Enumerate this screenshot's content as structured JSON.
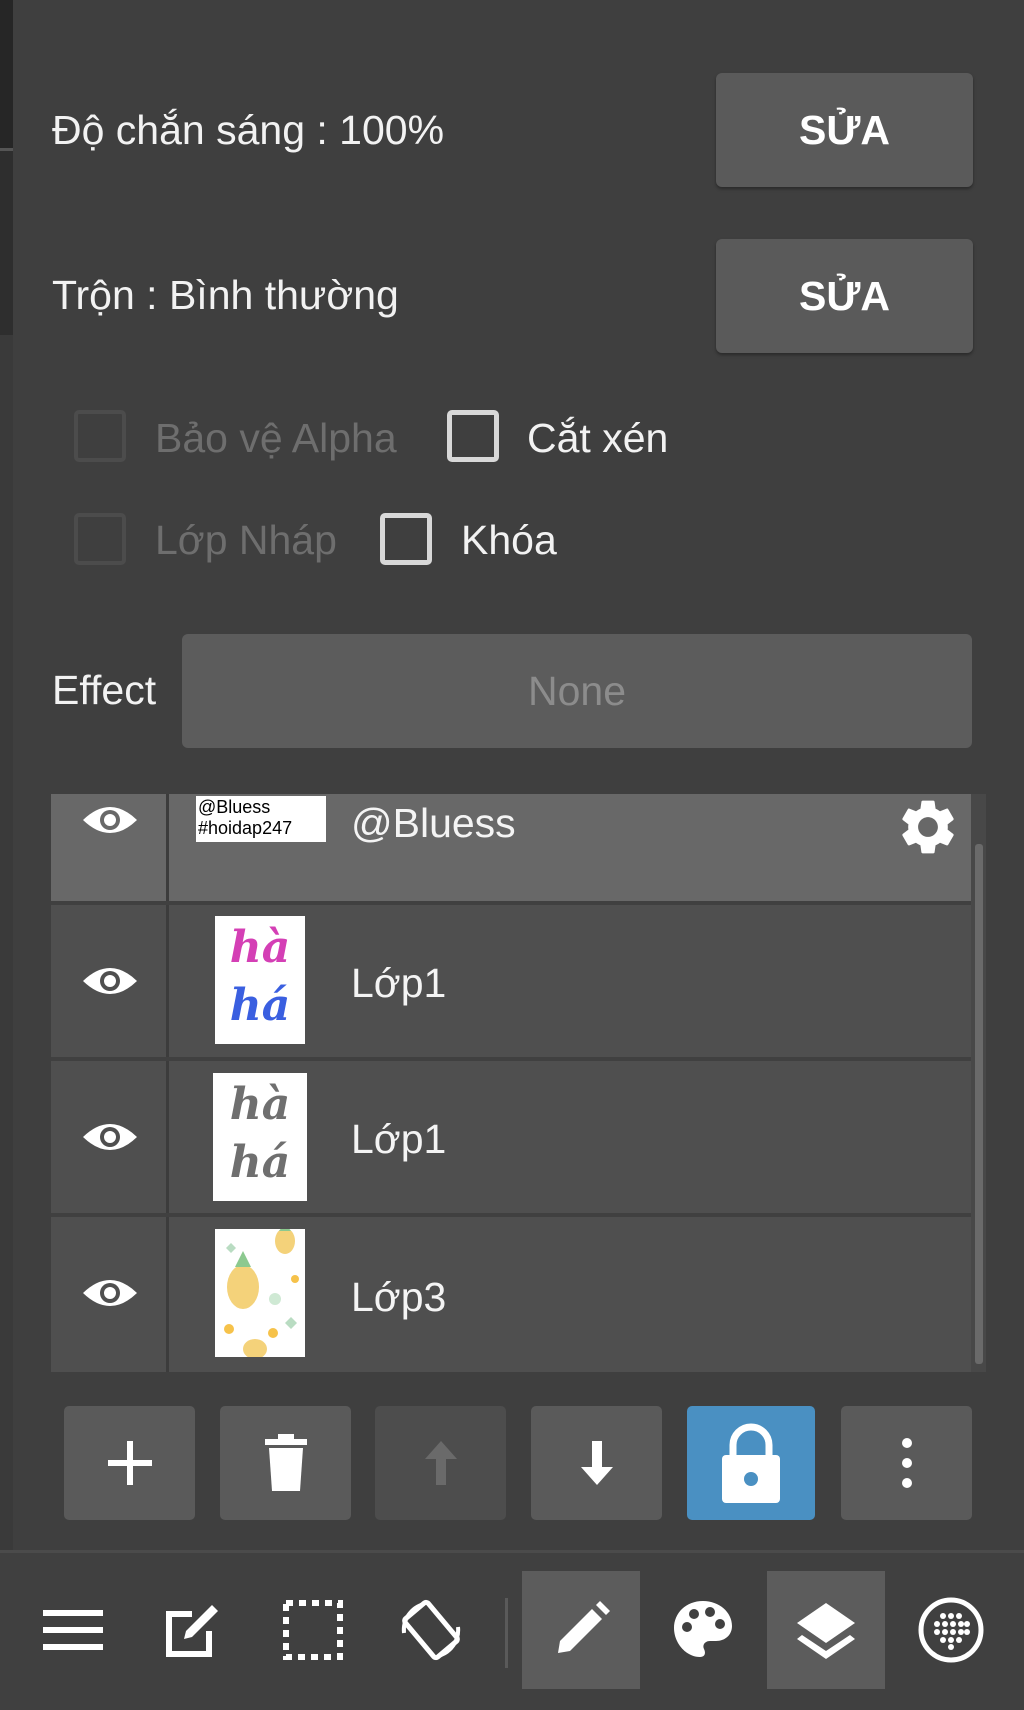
{
  "opacity": {
    "label": "Độ chắn sáng : 100%",
    "edit_label": "SỬA"
  },
  "blend": {
    "label": "Trộn : Bình thường",
    "edit_label": "SỬA"
  },
  "options": {
    "protect_alpha": {
      "label": "Bảo vệ Alpha",
      "checked": false,
      "enabled": false
    },
    "clipping": {
      "label": "Cắt xén",
      "checked": false,
      "enabled": true
    },
    "draft_layer": {
      "label": "Lớp Nháp",
      "checked": false,
      "enabled": false
    },
    "lock": {
      "label": "Khóa",
      "checked": false,
      "enabled": true
    }
  },
  "effect": {
    "label": "Effect",
    "value": "None"
  },
  "layers": [
    {
      "name": "@Bluess",
      "thumb_text": [
        "@Bluess",
        "#hoidap247"
      ],
      "selected": true,
      "visible": true,
      "icon": "gear-icon"
    },
    {
      "name": "Lớp1",
      "thumb_text": [
        "hà",
        "há"
      ],
      "selected": false,
      "visible": true
    },
    {
      "name": "Lớp1",
      "thumb_text": [
        "hà",
        "há"
      ],
      "selected": false,
      "visible": true
    },
    {
      "name": "Lớp3",
      "selected": false,
      "visible": true
    }
  ],
  "layer_toolbar": [
    "add-layer-button",
    "delete-layer-button",
    "move-up-button",
    "move-down-button",
    "lock-button",
    "more-button"
  ],
  "bottom_nav": [
    "menu-icon",
    "edit-icon",
    "selection-icon",
    "rotate-icon",
    "pen-icon",
    "palette-icon",
    "layers-icon",
    "grid-icon"
  ],
  "colors": {
    "background": "#3f3f3f",
    "button": "#5a5a5a",
    "accent": "#4a90c2",
    "selected_layer": "#686868"
  }
}
